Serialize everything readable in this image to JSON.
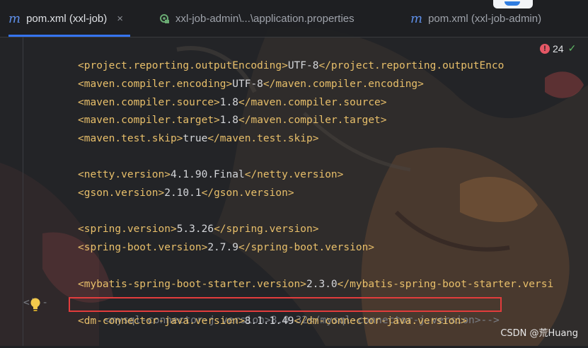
{
  "tabs": [
    {
      "icon": "maven-m-icon",
      "glyph": "m",
      "label": "pom.xml (xxl-job)",
      "active": true,
      "close": "×"
    },
    {
      "icon": "properties-gear-icon",
      "label": "xxl-job-admin\\...\\application.properties",
      "active": false
    },
    {
      "icon": "maven-m-icon",
      "glyph": "m",
      "label": "pom.xml (xxl-job-admin)",
      "active": false
    }
  ],
  "inspections": {
    "error_glyph": "!",
    "count": "24",
    "check_glyph": "✓"
  },
  "lines": [
    {
      "open": "<project.reporting.outputEncoding>",
      "value": "UTF-8",
      "close": "</project.reporting.outputEnco"
    },
    {
      "open": "<maven.compiler.encoding>",
      "value": "UTF-8",
      "close": "</maven.compiler.encoding>"
    },
    {
      "open": "<maven.compiler.source>",
      "value": "1.8",
      "close": "</maven.compiler.source>"
    },
    {
      "open": "<maven.compiler.target>",
      "value": "1.8",
      "close": "</maven.compiler.target>"
    },
    {
      "open": "<maven.test.skip>",
      "value": "true",
      "close": "</maven.test.skip>"
    },
    {
      "open": "<netty.version>",
      "value": "4.1.90.Final",
      "close": "</netty.version>"
    },
    {
      "open": "<gson.version>",
      "value": "2.10.1",
      "close": "</gson.version>"
    },
    {
      "open": "<spring.version>",
      "value": "5.3.26",
      "close": "</spring.version>"
    },
    {
      "open": "<spring-boot.version>",
      "value": "2.7.9",
      "close": "</spring-boot.version>"
    },
    {
      "open": "<mybatis-spring-boot-starter.version>",
      "value": "2.3.0",
      "close": "</mybatis-spring-boot-starter.versi"
    },
    {
      "comment_open": "<!--",
      "comment_body": "<mysql-connector-j.version>8.0.32</mysql-connector-j.version>-->"
    },
    {
      "open": "<dm-connector-java.version>",
      "value": "8.1.1.49",
      "close": "</dm-connector-java.version>"
    }
  ],
  "watermark": "CSDN @荒Huang",
  "colors": {
    "tag": "#e8bf6a",
    "comment": "#7a7e85",
    "accent": "#3574f0",
    "highlight_border": "#e23c3c"
  }
}
